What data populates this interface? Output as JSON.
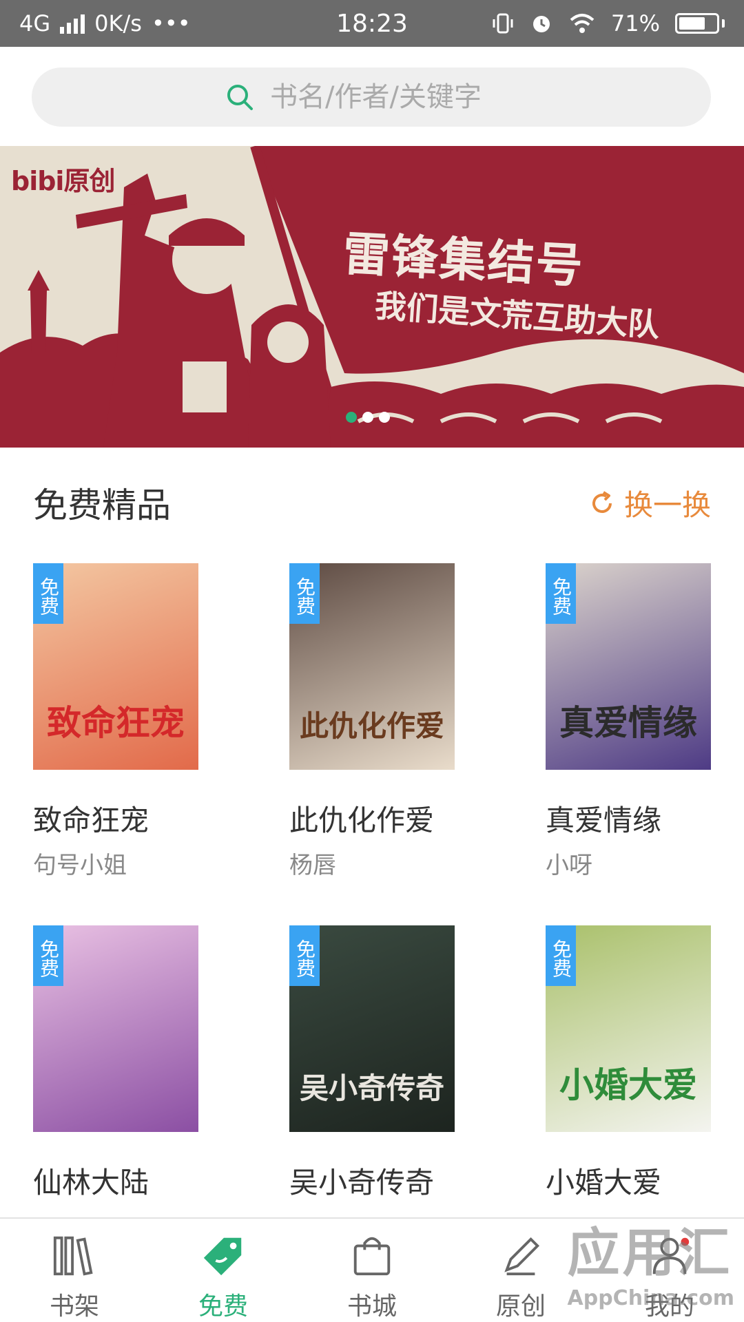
{
  "status_bar": {
    "network": "4G",
    "speed": "0K/s",
    "more": "•••",
    "time": "18:23",
    "battery": "71%",
    "battery_level": 0.71
  },
  "search": {
    "placeholder": "书名/作者/关键字"
  },
  "banner": {
    "logo": "bibi原创",
    "title": "雷锋集结号",
    "subtitle": "我们是文荒互助大队",
    "dots": 3,
    "active_dot": 0,
    "colors": {
      "background": "#e7dfd0",
      "red": "#9b2335"
    }
  },
  "section": {
    "title": "免费精品",
    "refresh_label": "换一换"
  },
  "badge_label": "免费",
  "books": [
    {
      "title": "致命狂宠",
      "author": "句号小姐",
      "cover_text": "致命狂宠",
      "cover_colors": [
        "#f3c7a2",
        "#e26a4a"
      ],
      "text_color": "#d4282a"
    },
    {
      "title": "此仇化作爱",
      "author": "杨唇",
      "cover_text": "此仇化作爱",
      "cover_colors": [
        "#5d4a42",
        "#e9dccb"
      ],
      "text_color": "#6a3b1f"
    },
    {
      "title": "真爱情缘",
      "author": "小呀",
      "cover_text": "真爱情缘",
      "cover_colors": [
        "#dcd4cc",
        "#4e3b85"
      ],
      "text_color": "#2b2b2b"
    },
    {
      "title": "仙林大陆",
      "author": "",
      "cover_text": "",
      "cover_colors": [
        "#e9c1e3",
        "#8b4fa3"
      ],
      "text_color": "#5a2e6e"
    },
    {
      "title": "吴小奇传奇",
      "author": "",
      "cover_text": "吴小奇传奇",
      "cover_colors": [
        "#3a4a40",
        "#1d241f"
      ],
      "text_color": "#e9e6df"
    },
    {
      "title": "小婚大爱",
      "author": "",
      "cover_text": "小婚大爱",
      "cover_colors": [
        "#a9c06a",
        "#f4f4f0"
      ],
      "text_color": "#2f8c3a"
    }
  ],
  "bottom_nav": [
    {
      "label": "书架",
      "icon": "bookshelf-icon"
    },
    {
      "label": "免费",
      "icon": "tag-icon",
      "active": true
    },
    {
      "label": "书城",
      "icon": "shopping-bag-icon"
    },
    {
      "label": "原创",
      "icon": "pen-icon"
    },
    {
      "label": "我的",
      "icon": "user-icon"
    }
  ],
  "watermark": {
    "main": "应用汇",
    "sub": "AppChina.com"
  },
  "colors": {
    "accent": "#2bb07a",
    "badge": "#3aa3f2",
    "refresh": "#e88a3c"
  }
}
